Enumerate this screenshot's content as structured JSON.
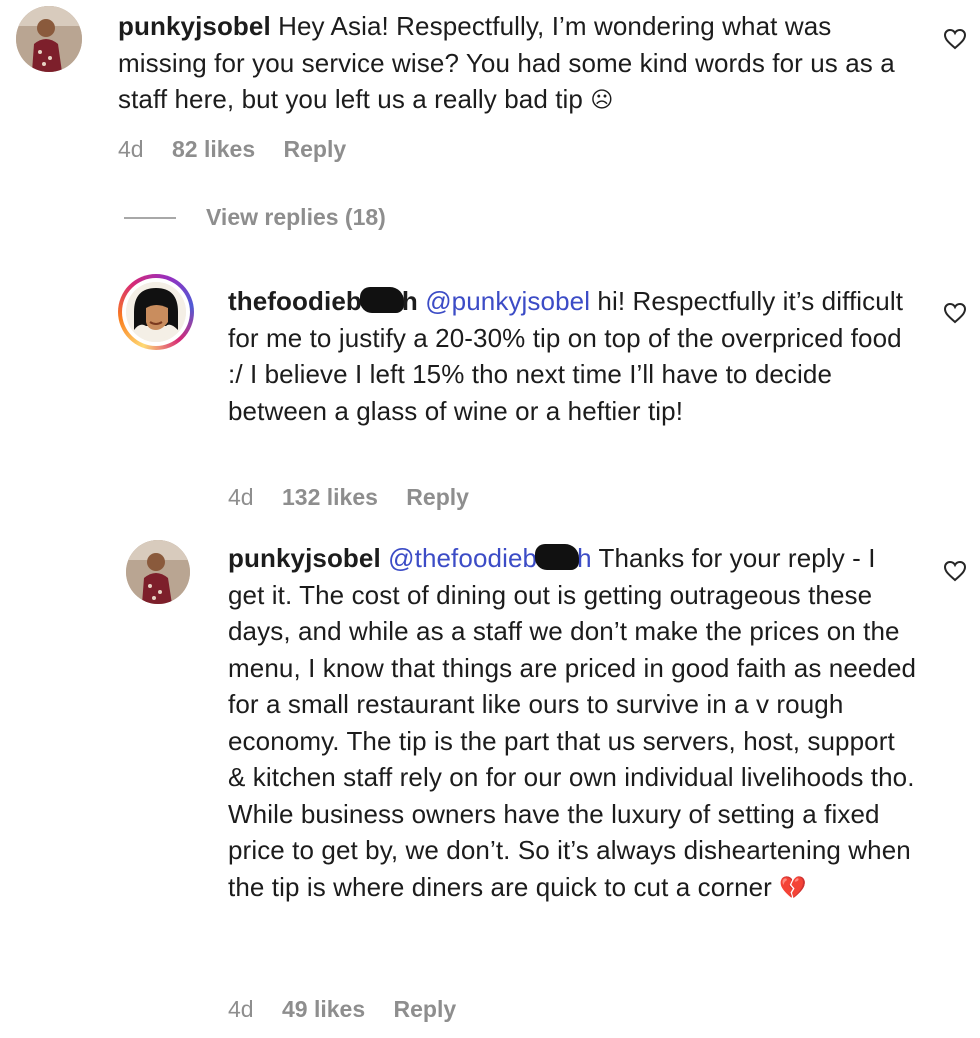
{
  "comments": [
    {
      "username": "punkyjsobel",
      "mention": "",
      "text": "Hey Asia! Respectfully, I’m wondering what was missing for you service wise? You had some kind words for us as a staff here, but you left us a really bad tip",
      "emoji": "☹",
      "time": "4d",
      "likes": "82 likes",
      "reply": "Reply"
    },
    {
      "username_start": "thefoodieb",
      "username_end": "h",
      "mention": "@punkyjsobel",
      "text": "hi! Respectfully it’s difficult for me to justify a 20-30% tip on top of the overpriced food :/ I believe I left 15% tho next time I’ll have to decide between a glass of wine or a heftier tip!",
      "time": "4d",
      "likes": "132 likes",
      "reply": "Reply"
    },
    {
      "username": "punkyjsobel",
      "mention_start": "@thefoodieb",
      "mention_end": "h",
      "text": "Thanks for your reply - I get it. The cost of dining out is getting outrageous these days, and while as a staff we don’t make the prices on the menu, I know that things are priced in good faith as needed for a small restaurant like ours to survive in a v rough economy. The tip is the part that us servers, host, support & kitchen staff rely on for our own individual livelihoods tho. While business owners have the luxury of setting a fixed price to get by, we don’t. So it’s always disheartening when the tip is where diners are quick to cut a corner",
      "emoji": "💔",
      "time": "4d",
      "likes": "49 likes",
      "reply": "Reply"
    }
  ],
  "view_replies": "View replies (18)",
  "colors": {
    "mention": "#3c4cc6",
    "meta": "#8e8e8e",
    "text": "#1c1c1c"
  },
  "icons": {
    "like": "heart-outline-icon"
  }
}
